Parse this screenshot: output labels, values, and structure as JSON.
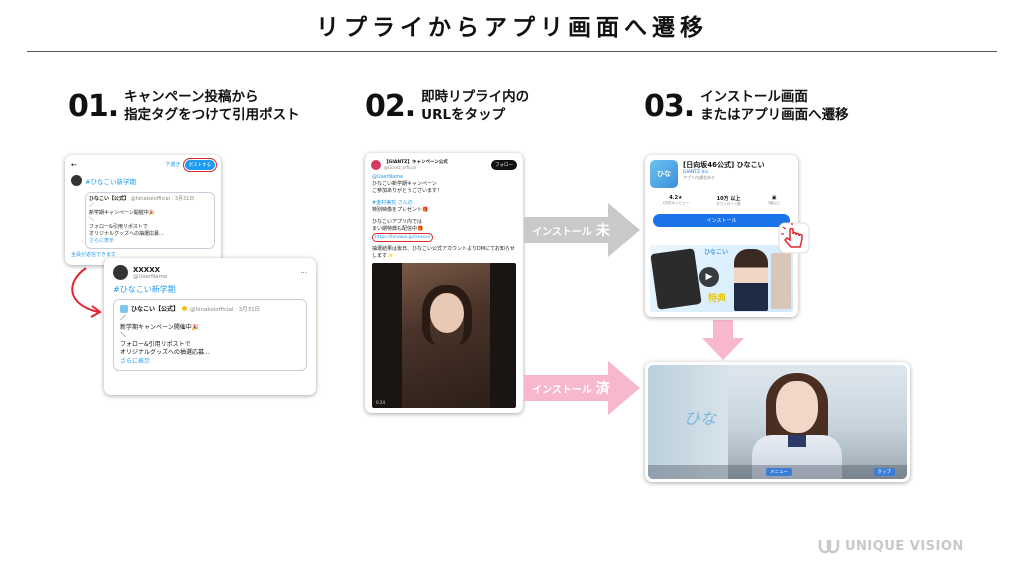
{
  "title": "リプライからアプリ画面へ遷移",
  "steps": [
    {
      "num": "01.",
      "line1": "キャンペーン投稿から",
      "line2": "指定タグをつけて引用ポスト"
    },
    {
      "num": "02.",
      "line1": "即時リプライ内の",
      "line2": "URLをタップ"
    },
    {
      "num": "03.",
      "line1": "インストール画面",
      "line2": "またはアプリ画面へ遷移"
    }
  ],
  "step1": {
    "back": "←",
    "draft": "下書き",
    "post_btn": "ポストする",
    "hashtag": "#ひなこい新学期",
    "quote_name": "ひなこい【公式】",
    "quote_handle": "@hinakoiofficial · 3月31日",
    "quote_lines": [
      "／",
      "新学期キャンペーン開催中🎉",
      "＼",
      "フォロー&引用リポストで",
      "オリジナルグッズへの抽選応募..."
    ],
    "more": "さらに表示",
    "reply_setting": "全員が返信できます",
    "zoom_user": "XXXXX",
    "zoom_handle": "@UserName",
    "zoom_hashtag": "#ひなこい新学期",
    "zoom_quote_name": "ひなこい【公式】",
    "zoom_quote_handle": "@hinakoiofficial · 3月31日",
    "zoom_lines": [
      "／",
      "新学期キャンペーン開催中🎉",
      "＼",
      "フォロー&引用リポストで",
      "オリジナルグッズへの抽選応募..."
    ],
    "zoom_more": "さらに表示"
  },
  "step2": {
    "account": "【GIANTZ】キャンペーン公式",
    "account_handle": "@Giantz_official",
    "follow": "フォロー",
    "mention": "@UserName",
    "lines": [
      "ひなこい新学期キャンペーン",
      "ご参加ありがとうございます！"
    ],
    "gift1": "#金村美玖 さんの",
    "gift2": "特別映像をプレゼント🎁",
    "app1": "ひなこいアプリ内では",
    "app2": "まい期特典も配信中🎁",
    "url": "https://hinakoi.jp/l/xxxxx",
    "result": "抽選結果は後日、ひなこい公式アカウントよりDMにてお知らせします✨",
    "video_time": "0:24"
  },
  "step3": {
    "app_name": "[日向坂46公式] ひなこい",
    "developer": "GIANTZ Inc.",
    "purchase": "アプリ内課金あり",
    "rating": "4.2★",
    "rating_label": "4万件のレビュー",
    "downloads": "10万 以上",
    "downloads_label": "ダウンロード数",
    "age": "3歳以上",
    "install_btn": "インストール",
    "promo_text": "ひなこい",
    "promo_sub": "特典"
  },
  "arrows": {
    "not_installed": "インストール",
    "not_installed_mark": "未",
    "installed": "インストール",
    "installed_mark": "済"
  },
  "app_screen": {
    "logo": "ひな",
    "btn1": "メニュー",
    "btn2": "タップ"
  },
  "brand": "UNIQUE VISION",
  "colors": {
    "accent": "#1d9bf0",
    "arrow_gray": "#c9c9c9",
    "arrow_pink": "#f7b8cd"
  }
}
